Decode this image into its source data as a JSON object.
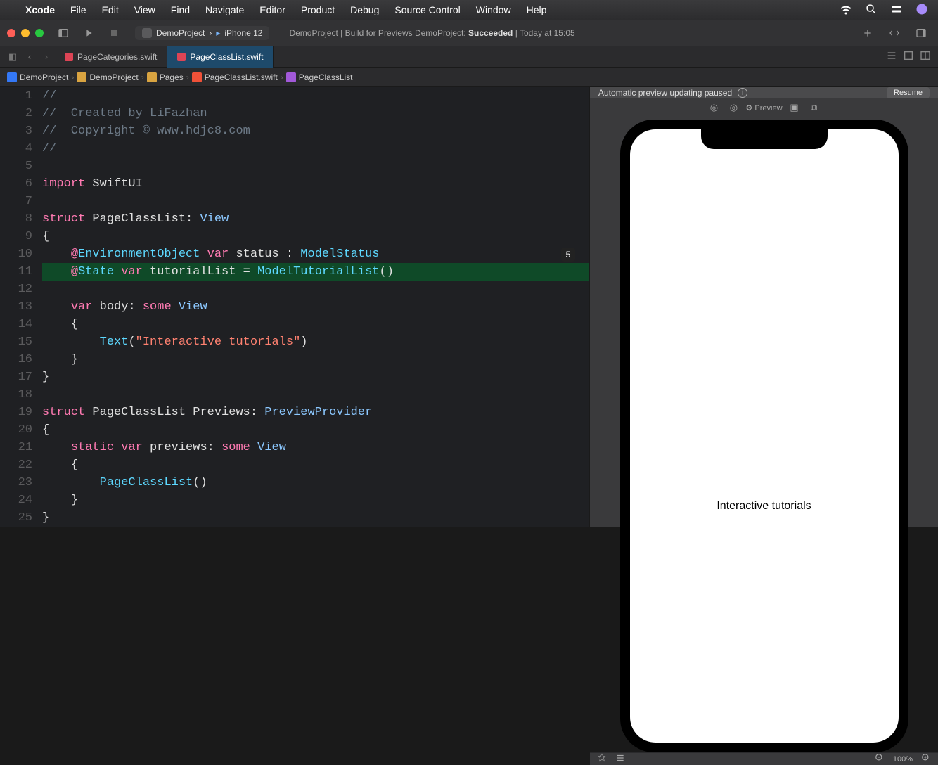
{
  "menubar": {
    "app": "Xcode",
    "items": [
      "File",
      "Edit",
      "View",
      "Find",
      "Navigate",
      "Editor",
      "Product",
      "Debug",
      "Source Control",
      "Window",
      "Help"
    ]
  },
  "scheme": {
    "project": "DemoProject",
    "device": "iPhone 12"
  },
  "status": {
    "prefix": "DemoProject | Build for Previews DemoProject:",
    "result": "Succeeded",
    "time": "| Today at 15:05"
  },
  "tabs": [
    {
      "label": "PageCategories.swift"
    },
    {
      "label": "PageClassList.swift"
    }
  ],
  "breadcrumbs": [
    "DemoProject",
    "DemoProject",
    "Pages",
    "PageClassList.swift",
    "PageClassList"
  ],
  "code": {
    "badge": "5",
    "lines": [
      {
        "n": 1,
        "t": "comment",
        "text": "//"
      },
      {
        "n": 2,
        "t": "comment",
        "text": "//  Created by LiFazhan"
      },
      {
        "n": 3,
        "t": "comment",
        "text": "//  Copyright © www.hdjc8.com"
      },
      {
        "n": 4,
        "t": "comment",
        "text": "//"
      },
      {
        "n": 5,
        "t": "blank",
        "text": ""
      },
      {
        "n": 6,
        "t": "import",
        "k1": "import",
        "rest": " SwiftUI"
      },
      {
        "n": 7,
        "t": "blank",
        "text": ""
      },
      {
        "n": 8,
        "t": "struct1",
        "k1": "struct",
        "name": " PageClassList",
        "colon": ": ",
        "proto": "View"
      },
      {
        "n": 9,
        "t": "plain",
        "text": "{"
      },
      {
        "n": 10,
        "t": "envobj",
        "at": "@",
        "attr": "EnvironmentObject",
        "sp1": " ",
        "var": "var",
        "sp2": " status : ",
        "type": "ModelStatus"
      },
      {
        "n": 11,
        "t": "state",
        "hl": true,
        "at": "@",
        "attr": "State",
        "sp1": " ",
        "var": "var",
        "sp2": " tutorialList = ",
        "type": "ModelTutorialList",
        "paren": "()"
      },
      {
        "n": 12,
        "t": "blank",
        "text": ""
      },
      {
        "n": 13,
        "t": "body",
        "var": "var",
        "name": " body",
        "colon": ": ",
        "some": "some",
        "sp": " ",
        "view": "View"
      },
      {
        "n": 14,
        "t": "plain",
        "text": "    {"
      },
      {
        "n": 15,
        "t": "textcall",
        "type": "Text",
        "open": "(",
        "str": "\"Interactive tutorials\"",
        "close": ")"
      },
      {
        "n": 16,
        "t": "plain",
        "text": "    }"
      },
      {
        "n": 17,
        "t": "plain",
        "text": "}"
      },
      {
        "n": 18,
        "t": "blank",
        "text": ""
      },
      {
        "n": 19,
        "t": "struct2",
        "k1": "struct",
        "name": " PageClassList_Previews",
        "colon": ": ",
        "proto": "PreviewProvider"
      },
      {
        "n": 20,
        "t": "plain",
        "text": "{"
      },
      {
        "n": 21,
        "t": "previews",
        "static": "static",
        "sp1": " ",
        "var": "var",
        "name": " previews",
        "colon": ": ",
        "some": "some",
        "sp2": " ",
        "view": "View"
      },
      {
        "n": 22,
        "t": "plain",
        "text": "    {"
      },
      {
        "n": 23,
        "t": "call",
        "type": "PageClassList",
        "paren": "()"
      },
      {
        "n": 24,
        "t": "plain",
        "text": "    }"
      },
      {
        "n": 25,
        "t": "plain",
        "text": "}"
      }
    ]
  },
  "preview": {
    "banner": "Automatic preview updating paused",
    "resume": "Resume",
    "label": "Preview",
    "content_text": "Interactive tutorials",
    "zoom": "100%"
  }
}
